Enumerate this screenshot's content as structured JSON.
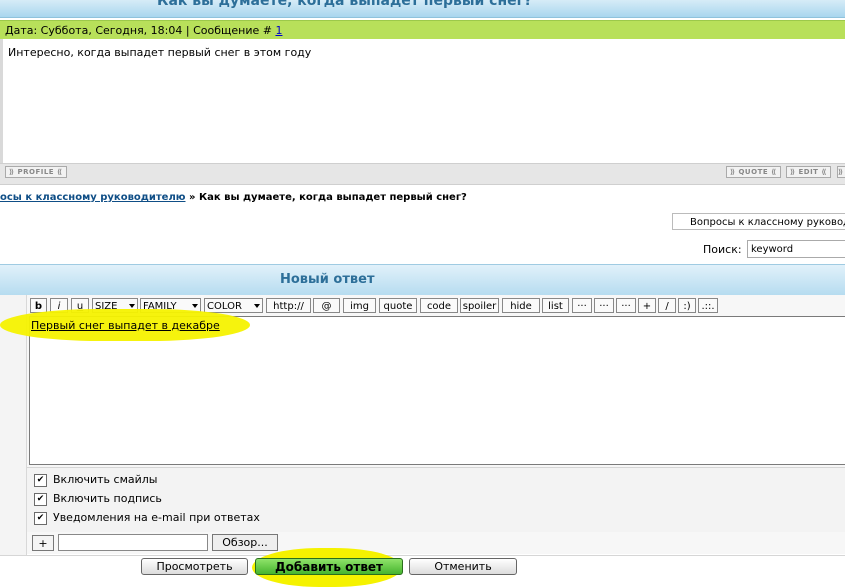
{
  "topic": {
    "title": "Как вы думаете, когда выпадет первый снег?"
  },
  "post": {
    "meta_prefix": "Дата: Суббота, Сегодня, 18:04 | Сообщение # ",
    "number": "1",
    "text": "Интересно, когда выпадет первый снег в этом году",
    "profile_label": "PROFILE",
    "quote_label": "QUOTE",
    "edit_label": "EDIT"
  },
  "breadcrumb": {
    "link": "осы к классному руководителю",
    "separator": " » ",
    "current": "Как вы думаете, когда выпадет первый снег?"
  },
  "forum_select": {
    "value": "Вопросы к классному руковод"
  },
  "search": {
    "label": "Поиск:",
    "value": "keyword"
  },
  "reply": {
    "title": "Новый ответ",
    "text": "Первый снег выпадет в декабре"
  },
  "toolbar": {
    "bold": "b",
    "italic": "i",
    "underline": "u",
    "size": "SIZE",
    "family": "FAMILY",
    "color": "COLOR",
    "url": "http://",
    "email": "@",
    "img": "img",
    "quote": "quote",
    "code": "code",
    "spoiler": "spoiler",
    "hide": "hide",
    "list": "list",
    "dots1": "···",
    "dots2": "···",
    "dots3": "···",
    "plus": "+",
    "slash": "/",
    "smile": ":)",
    "more": ".::."
  },
  "options": [
    {
      "label": "Включить смайлы",
      "checked": true
    },
    {
      "label": "Включить подпись",
      "checked": true
    },
    {
      "label": "Уведомления на e-mail при ответах",
      "checked": true
    }
  ],
  "attach": {
    "add": "+",
    "browse": "Обзор..."
  },
  "buttons": {
    "preview": "Просмотреть",
    "submit": "Добавить ответ",
    "cancel": "Отменить"
  },
  "colors": {
    "header_blue": "#2d6f99",
    "post_bar_green": "#b8e05a",
    "highlight_yellow": "#f5f200",
    "submit_green": "#46b42f"
  }
}
